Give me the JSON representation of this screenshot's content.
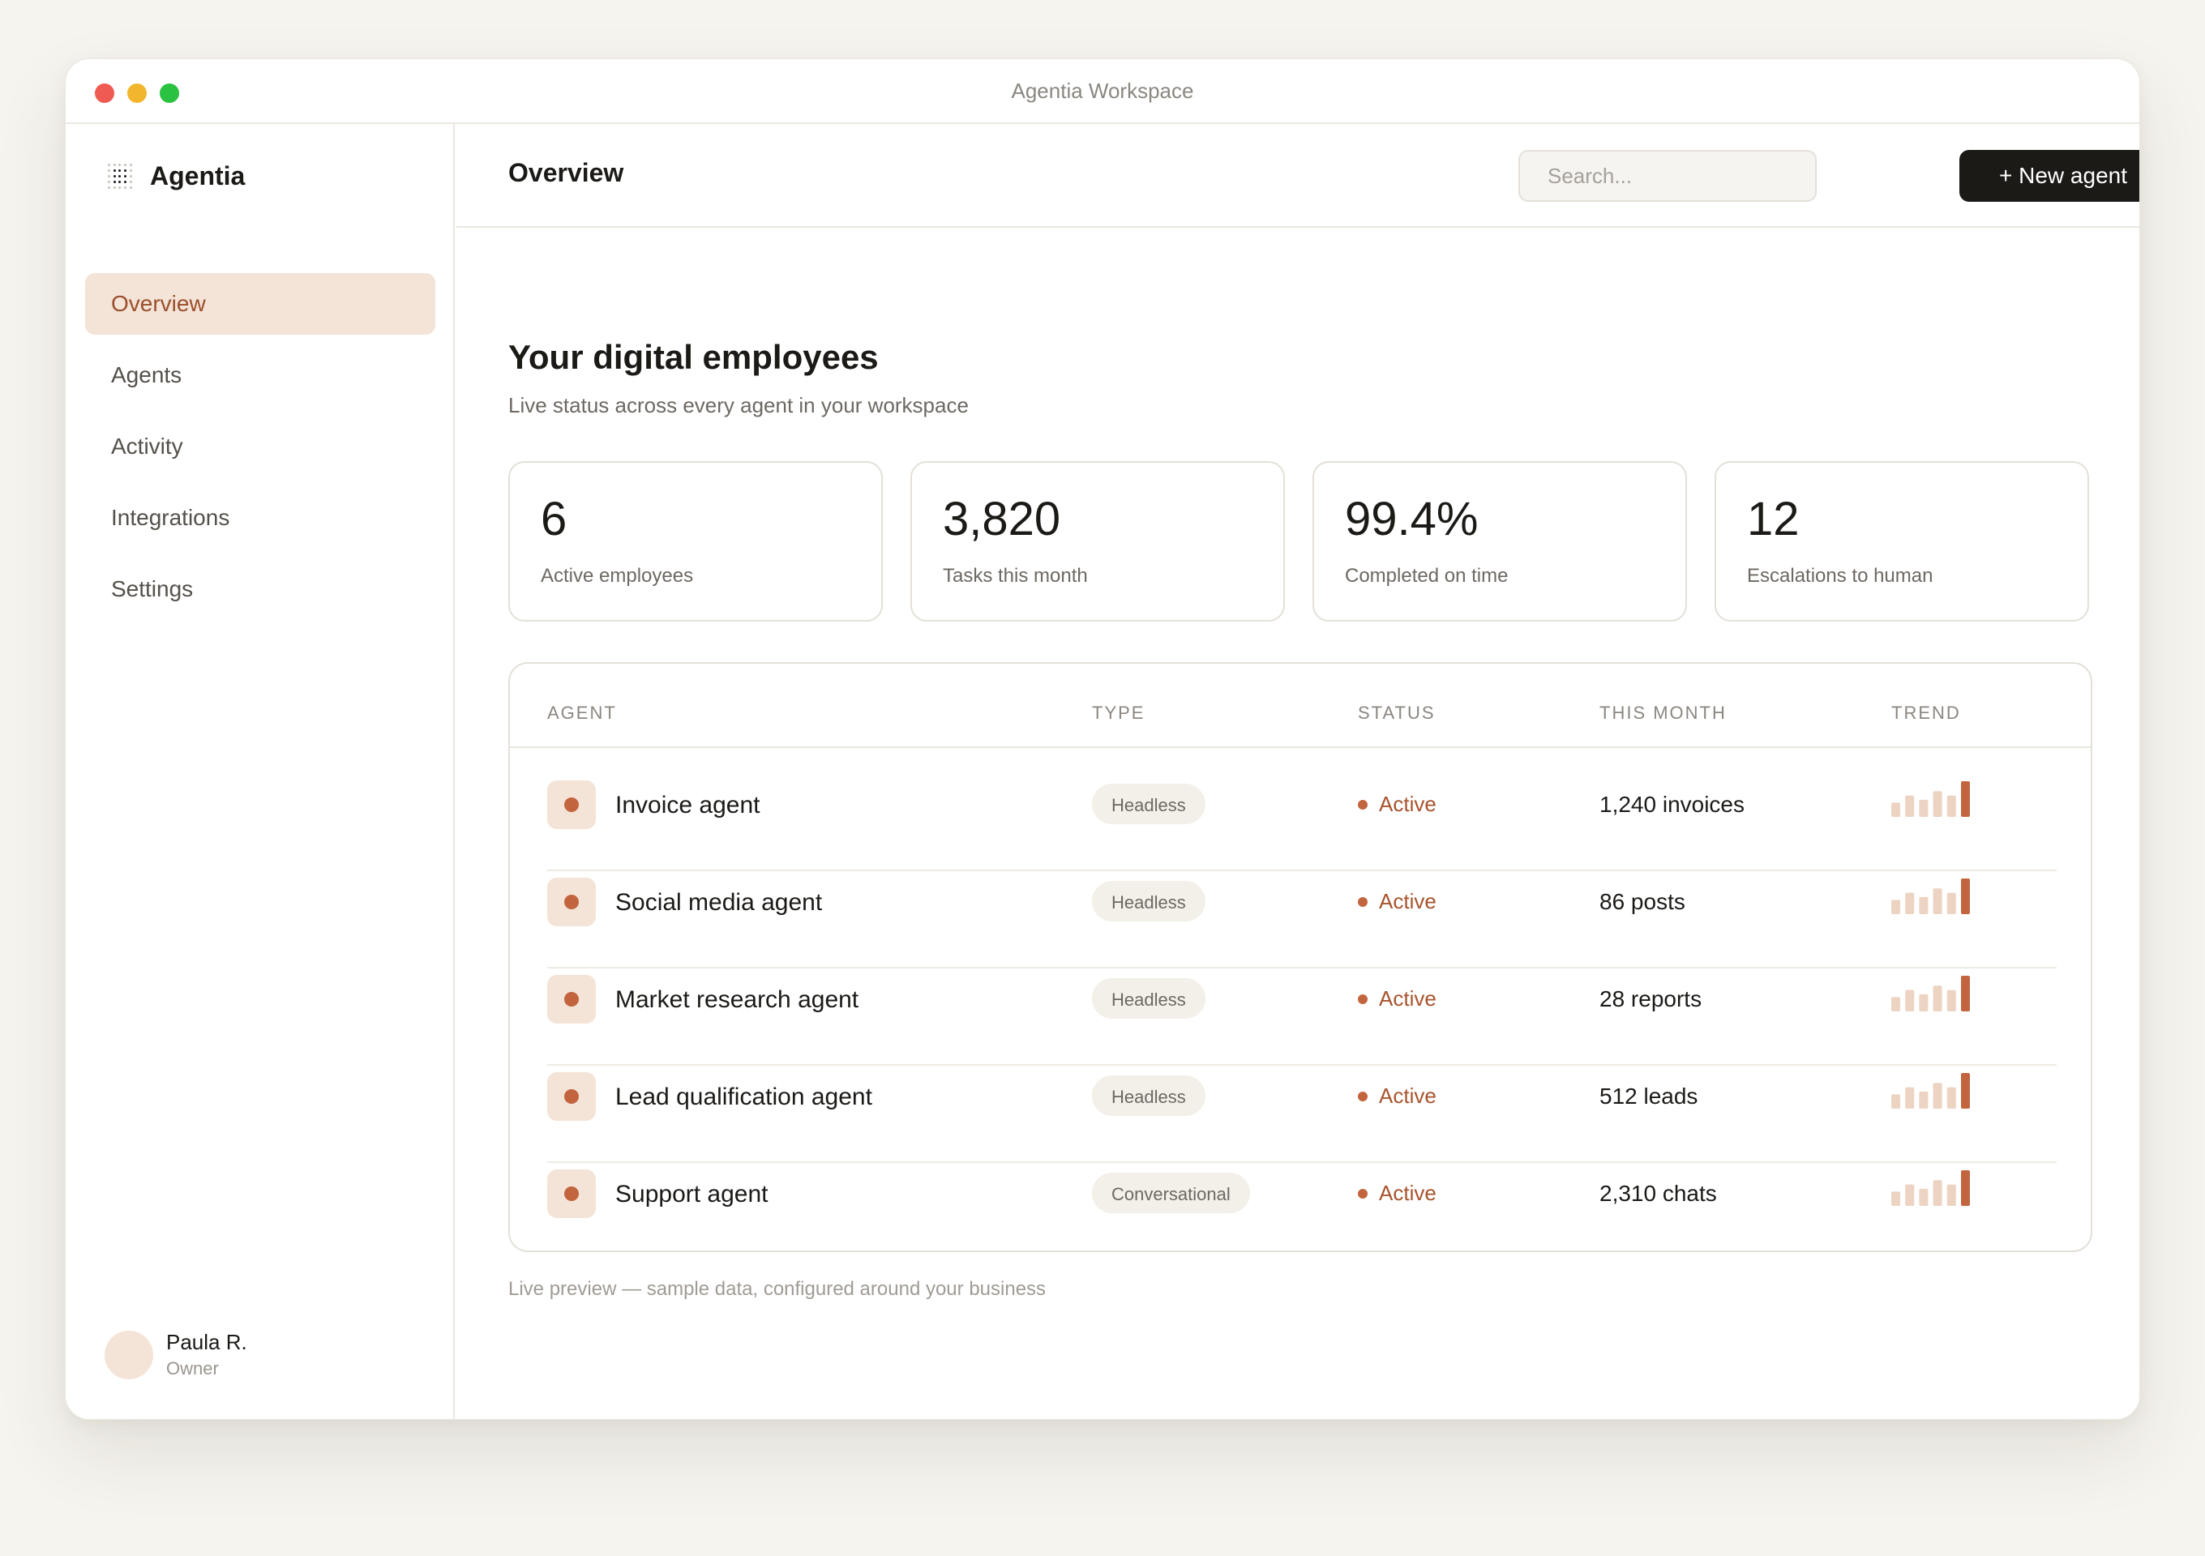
{
  "window": {
    "title": "Agentia Workspace"
  },
  "sidebar": {
    "brand": "Agentia",
    "items": [
      {
        "label": "Overview",
        "active": true
      },
      {
        "label": "Agents",
        "active": false
      },
      {
        "label": "Activity",
        "active": false
      },
      {
        "label": "Integrations",
        "active": false
      },
      {
        "label": "Settings",
        "active": false
      }
    ],
    "user": {
      "name": "Paula R.",
      "role": "Owner"
    }
  },
  "header": {
    "title": "Overview",
    "search_placeholder": "Search...",
    "new_button": "+ New agent"
  },
  "main": {
    "heading": "Your digital employees",
    "subheading": "Live status across every agent in your workspace",
    "stats": [
      {
        "value": "6",
        "label": "Active employees"
      },
      {
        "value": "3,820",
        "label": "Tasks this month"
      },
      {
        "value": "99.4%",
        "label": "Completed on time"
      },
      {
        "value": "12",
        "label": "Escalations to human"
      }
    ],
    "table": {
      "columns": [
        "AGENT",
        "TYPE",
        "STATUS",
        "THIS MONTH",
        "TREND"
      ],
      "rows": [
        {
          "agent": "Invoice agent",
          "type": "Headless",
          "status": "Active",
          "month": "1,240 invoices",
          "trend": [
            2,
            3,
            2.4,
            3.6,
            3,
            5
          ]
        },
        {
          "agent": "Social media agent",
          "type": "Headless",
          "status": "Active",
          "month": "86 posts",
          "trend": [
            2,
            3,
            2.4,
            3.6,
            3,
            5
          ]
        },
        {
          "agent": "Market research agent",
          "type": "Headless",
          "status": "Active",
          "month": "28 reports",
          "trend": [
            2,
            3,
            2.4,
            3.6,
            3,
            5
          ]
        },
        {
          "agent": "Lead qualification agent",
          "type": "Headless",
          "status": "Active",
          "month": "512 leads",
          "trend": [
            2,
            3,
            2.4,
            3.6,
            3,
            5
          ]
        },
        {
          "agent": "Support agent",
          "type": "Conversational",
          "status": "Active",
          "month": "2,310 chats",
          "trend": [
            2,
            3,
            2.4,
            3.6,
            3,
            5
          ]
        }
      ]
    },
    "footnote": "Live preview — sample data, configured around your business"
  },
  "colors": {
    "accent": "#c2653e",
    "accent_soft": "#f4e3d7",
    "trend_light": "#ecd3c2",
    "dark": "#1c1a17"
  }
}
